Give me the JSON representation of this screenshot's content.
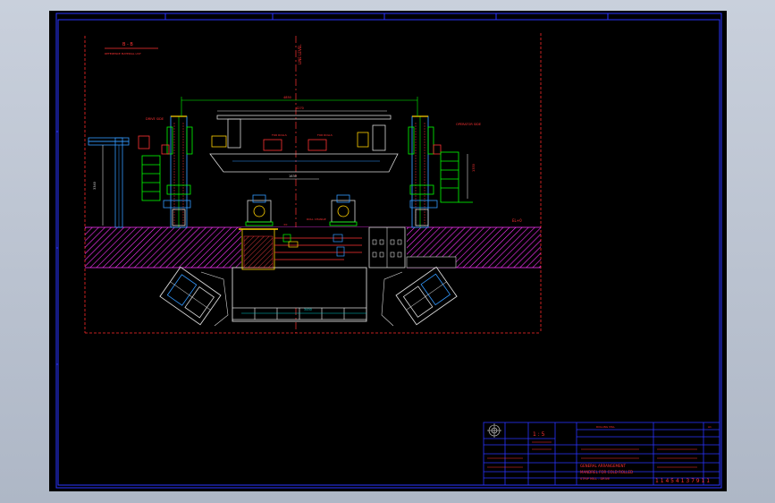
{
  "drawing": {
    "section_title": "B - B",
    "section_subtitle": "REFERENCE MATERIAL LIST",
    "level_label": "LINE LEVEL",
    "dim_top": "4850",
    "dim_beam": "4270",
    "dim_inner": "1630",
    "dim_bottom": "3450",
    "dim_left_height": "3340",
    "dim_right_height": "1350",
    "label_left_side": "DRIVE SIDE",
    "label_right_side": "OPERATOR SIDE",
    "label_mid_left": "FOR ROLLS",
    "label_mid_right": "FOR ROLLS",
    "label_center_tag": "ROLL CHANGE",
    "label_zero": "±0",
    "label_elev": "EL+0"
  },
  "title_block": {
    "scale": "1 : 5",
    "title_line1": "GENERAL ARRANGEMENT",
    "title_line2": "MANDREL FOR COLD ROLLED",
    "title_line3": "STRIP MILL - DRIVE",
    "drawing_number": "1 1 4 5 4 1 3 7 9  1 1",
    "company": "ROLLING MILL",
    "size": "A1"
  },
  "colors": {
    "background": "#000000",
    "frame": "#2a34ff",
    "section": "#ff33ff",
    "steel": "#e0e0e0",
    "dimension": "#00c8c8",
    "machine": "#3399ff",
    "centerline": "#ff2222",
    "accent": "#00ff00",
    "yellow": "#ffff00"
  }
}
